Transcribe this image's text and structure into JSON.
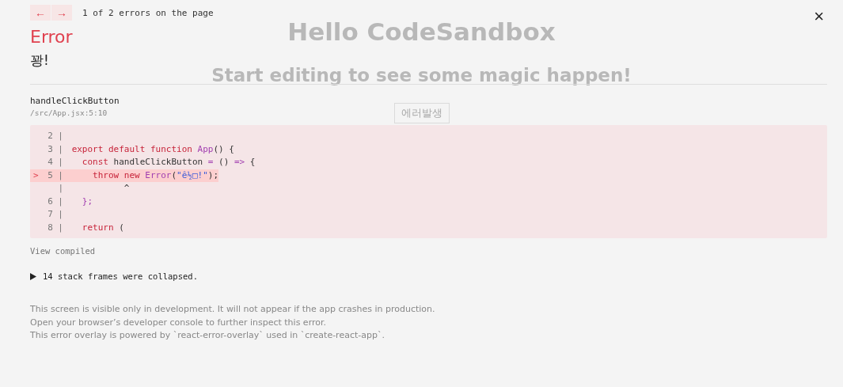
{
  "background_page": {
    "title": "Hello CodeSandbox",
    "subtitle": "Start editing to see some magic happen!",
    "button": "에러발생"
  },
  "navigation": {
    "prev": "←",
    "next": "→",
    "counter": "1 of 2 errors on the page"
  },
  "close": "×",
  "error": {
    "heading": "Error",
    "message": "꽝!"
  },
  "frame": {
    "function": "handleClickButton",
    "location": "/src/App.jsx:5:10"
  },
  "code": [
    {
      "gutter": "2 |",
      "highlighted": false
    },
    {
      "gutter": "3 |",
      "highlighted": false,
      "tokens": [
        {
          "kind": "keyword",
          "text": "export default function "
        },
        {
          "kind": "name",
          "text": "App"
        },
        {
          "kind": "plain",
          "text": "() {"
        }
      ]
    },
    {
      "gutter": "4 |",
      "highlighted": false,
      "tokens": [
        {
          "kind": "keyword",
          "text": "  const "
        },
        {
          "kind": "plain",
          "text": "handleClickButton "
        },
        {
          "kind": "punct",
          "text": "="
        },
        {
          "kind": "plain",
          "text": " () "
        },
        {
          "kind": "punct",
          "text": "=>"
        },
        {
          "kind": "plain",
          "text": " {"
        }
      ]
    },
    {
      "marker": ">",
      "gutter": "5 |",
      "highlighted": true,
      "tokens": [
        {
          "kind": "keyword",
          "text": "    throw new "
        },
        {
          "kind": "name",
          "text": "Error"
        },
        {
          "kind": "plain",
          "text": "("
        },
        {
          "kind": "string",
          "text": "\"ê½□!\""
        },
        {
          "kind": "plain",
          "text": ");"
        }
      ]
    },
    {
      "gutter": "|",
      "highlighted": false,
      "tokens": [
        {
          "kind": "plain",
          "text": "          ^"
        }
      ]
    },
    {
      "gutter": "6 |",
      "highlighted": false,
      "tokens": [
        {
          "kind": "punct",
          "text": "  };"
        }
      ]
    },
    {
      "gutter": "7 |",
      "highlighted": false
    },
    {
      "gutter": "8 |",
      "highlighted": false,
      "tokens": [
        {
          "kind": "keyword",
          "text": "  return "
        },
        {
          "kind": "plain",
          "text": "("
        }
      ]
    }
  ],
  "view_compiled": "View compiled",
  "stack": {
    "expanded": false,
    "label": "14 stack frames were collapsed."
  },
  "footer": [
    "This screen is visible only in development. It will not appear if the app crashes in production.",
    "Open your browser’s developer console to further inspect this error.",
    "This error overlay is powered by `react-error-overlay` used in `create-react-app`."
  ]
}
